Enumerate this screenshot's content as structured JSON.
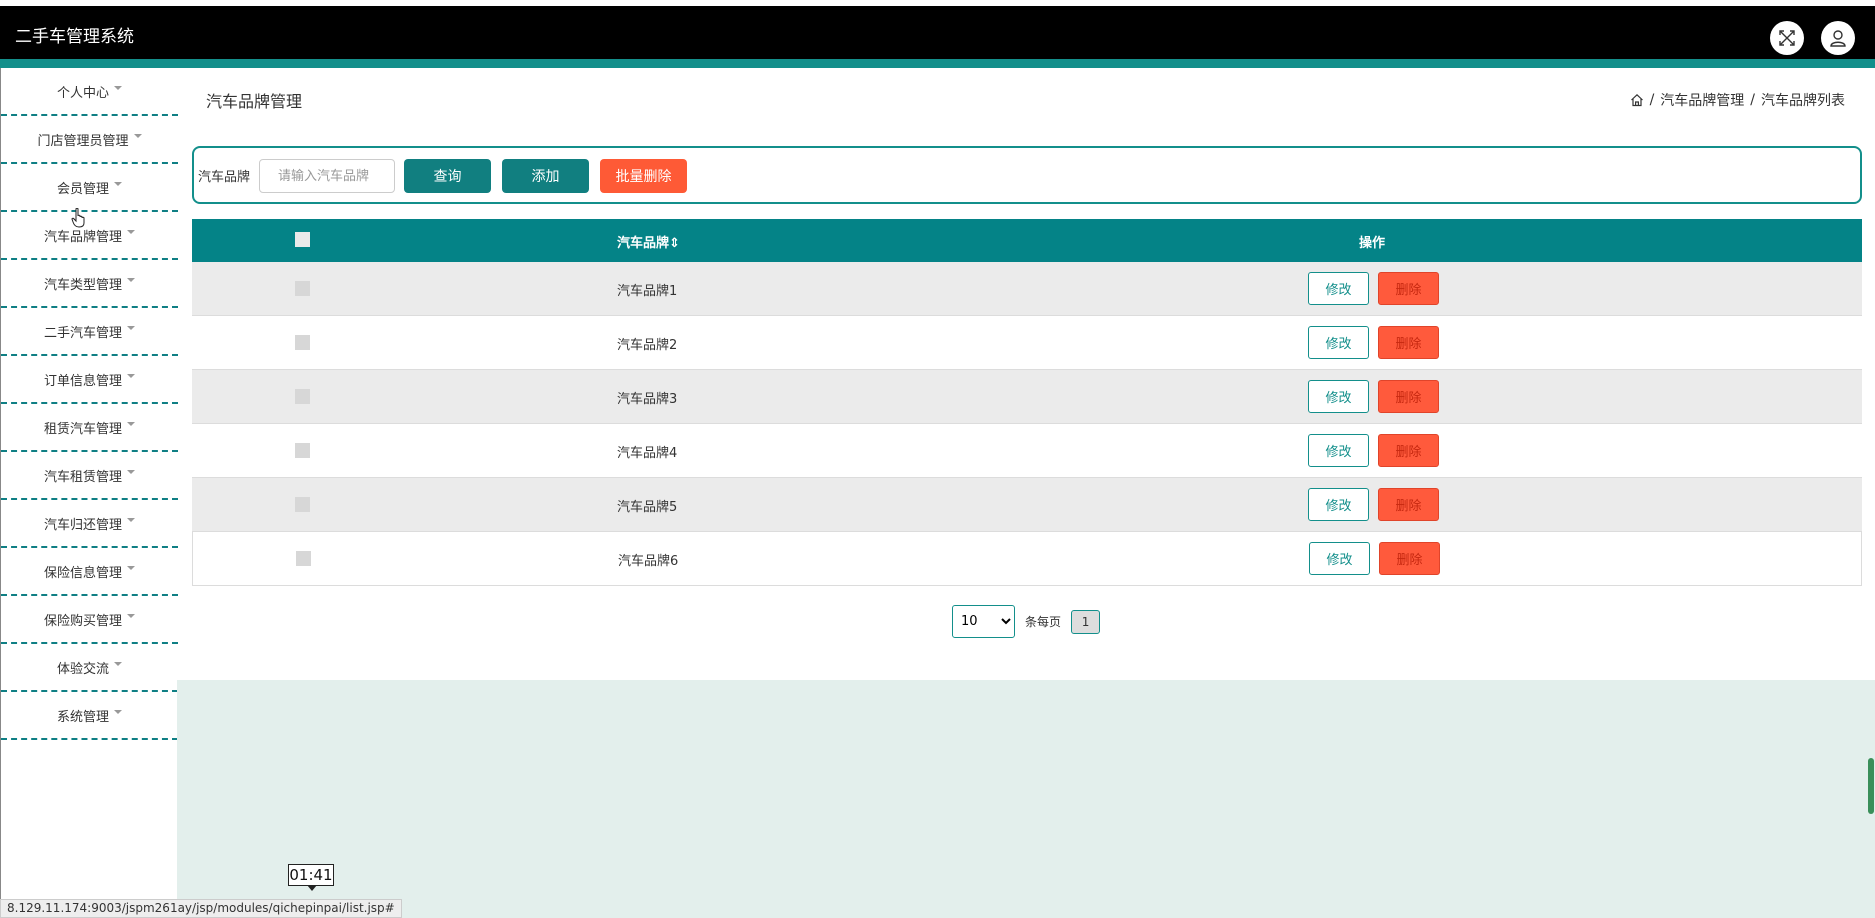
{
  "app": {
    "title": "二手车管理系统"
  },
  "header": {
    "fullscreen_icon": "fullscreen-icon",
    "user_icon": "user-icon"
  },
  "sidebar": {
    "items": [
      {
        "label": "个人中心"
      },
      {
        "label": "门店管理员管理"
      },
      {
        "label": "会员管理"
      },
      {
        "label": "汽车品牌管理"
      },
      {
        "label": "汽车类型管理"
      },
      {
        "label": "二手汽车管理"
      },
      {
        "label": "订单信息管理"
      },
      {
        "label": "租赁汽车管理"
      },
      {
        "label": "汽车租赁管理"
      },
      {
        "label": "汽车归还管理"
      },
      {
        "label": "保险信息管理"
      },
      {
        "label": "保险购买管理"
      },
      {
        "label": "体验交流"
      },
      {
        "label": "系统管理"
      }
    ]
  },
  "page": {
    "title": "汽车品牌管理",
    "breadcrumb": [
      "汽车品牌管理",
      "汽车品牌列表"
    ],
    "breadcrumb_sep": "/"
  },
  "search": {
    "label": "汽车品牌",
    "placeholder": "请输入汽车品牌",
    "query_label": "查询",
    "add_label": "添加",
    "batch_delete_label": "批量删除"
  },
  "table": {
    "columns": [
      "汽车品牌",
      "操作"
    ],
    "sort_glyph": "⇕",
    "rows": [
      {
        "brand": "汽车品牌1",
        "edit": "修改",
        "delete": "删除"
      },
      {
        "brand": "汽车品牌2",
        "edit": "修改",
        "delete": "删除"
      },
      {
        "brand": "汽车品牌3",
        "edit": "修改",
        "delete": "删除"
      },
      {
        "brand": "汽车品牌4",
        "edit": "修改",
        "delete": "删除"
      },
      {
        "brand": "汽车品牌5",
        "edit": "修改",
        "delete": "删除"
      },
      {
        "brand": "汽车品牌6",
        "edit": "修改",
        "delete": "删除"
      }
    ]
  },
  "pagination": {
    "page_size": "10",
    "per_page_label": "条每页",
    "current_page": "1"
  },
  "overlay": {
    "timer": "01:41",
    "status_url": "8.129.11.174:9003/jspm261ay/jsp/modules/qichepinpai/list.jsp#"
  },
  "colors": {
    "teal": "#138f8b",
    "header_black": "#000000",
    "orange": "#fe5a36",
    "main_bg": "#e3efec"
  }
}
